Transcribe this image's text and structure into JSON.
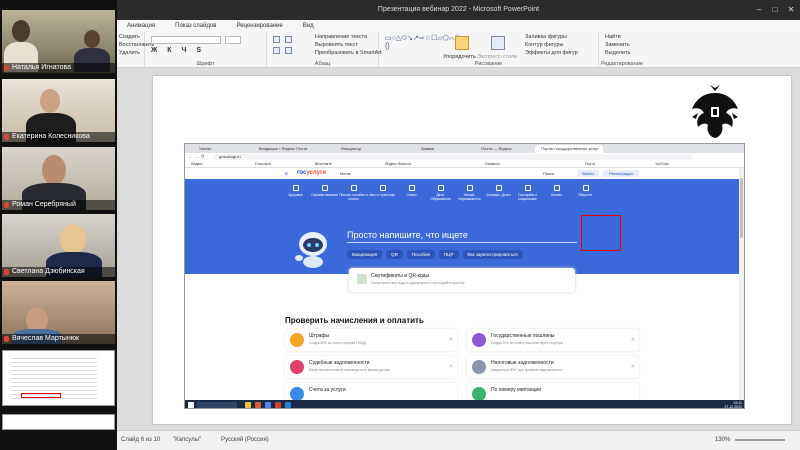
{
  "participants": [
    {
      "name": "Наталья Игнатова"
    },
    {
      "name": "Екатерина Колесникова"
    },
    {
      "name": "Роман Серебряный"
    },
    {
      "name": "Светлана Дзюбинская"
    },
    {
      "name": "Вячеслав Мартынюк"
    }
  ],
  "ppt": {
    "window_title": "Презентация вебинар 2022  -  Microsoft PowerPoint",
    "menu": [
      "Анимация",
      "Показ слайдов",
      "Рецензирование",
      "Вид"
    ],
    "ribbon": {
      "clipboard_items": [
        "Создать",
        "Восстановить",
        "Удалить"
      ],
      "font_label": "Шрифт",
      "paragraph_label": "Абзац",
      "paragraph_items": [
        "Направление текста",
        "Выровнять текст",
        "Преобразовать в SmartArt"
      ],
      "drawing_label": "Рисование",
      "arrange_label": "Упорядочить",
      "quick_styles_label": "Экспресс-стили",
      "shape_items": [
        "Заливка фигуры",
        "Контур фигуры",
        "Эффекты для фигур"
      ],
      "editing_label": "Редактирование",
      "editing_items": [
        "Найти",
        "Заменить",
        "Выделить"
      ]
    },
    "status": {
      "slide": "Слайд 6 из 10",
      "theme": "\"Капсулы\"",
      "language": "Русский (Россия)",
      "zoom": "130%"
    }
  },
  "browser": {
    "tabs": [
      "Узнать",
      "Входящие • Яндекс Почта",
      "Инициатор",
      "Заявки",
      "Почта — Яндекс",
      "Портал государственных услуг"
    ],
    "url": "gosuslugi.ru",
    "bookmarks": [
      "Яндекс",
      "Госуслуги",
      "ВКонтакте",
      "Яндекс Новости",
      "Сервисы",
      "Почта",
      "YouTube"
    ],
    "header": {
      "logo_a": "гос",
      "logo_b": "услуги",
      "menu": "Меню",
      "search": "Поиск",
      "login": "Войти",
      "register": "Регистрация"
    },
    "nav": [
      {
        "label": "Здоровье"
      },
      {
        "label": "Справки выписки"
      },
      {
        "label": "Пенсии, пособия и льготы"
      },
      {
        "label": "Авто и транспорт"
      },
      {
        "label": "Семья"
      },
      {
        "label": "Дети. Образование"
      },
      {
        "label": "Жильё. Недвижимость"
      },
      {
        "label": "Штрафы. Долги"
      },
      {
        "label": "Госслужба и социальные"
      },
      {
        "label": "Бизнес"
      },
      {
        "label": "Обществ."
      }
    ],
    "search_prompt": "Просто напишите, что ищете",
    "chips": [
      "Вакцинация",
      "QR",
      "Пособия",
      "ПЦР",
      "Как зарегистрироваться"
    ],
    "card": {
      "title": "Сертификаты и QR-коды",
      "subtitle": "Посмотрите все коды в одном месте или подайте жалобу"
    },
    "check_title": "Проверить начисления и оплатить",
    "services": [
      {
        "title": "Штрафы",
        "subtitle": "Скидка 50% на оплату штрафа ГИБДД"
      },
      {
        "title": "Государственные пошлины",
        "subtitle": "Скидка 30% на оплату пошлины через госуслуги"
      },
      {
        "title": "Судебные задолженности",
        "subtitle": "Поиск исполнительных производств по вашим данным"
      },
      {
        "title": "Налоговые задолженности",
        "subtitle": "Сведения из ФНС для проверки задолженности"
      },
      {
        "title": "Счета за услуги",
        "subtitle": ""
      },
      {
        "title": "По номеру квитанции",
        "subtitle": ""
      }
    ],
    "clock": {
      "time": "15:11",
      "date": "27.12.2021"
    }
  },
  "colors": {
    "gosuslugi_blue": "#3a6ad9",
    "logo_blue": "#0d4cd3",
    "logo_red": "#e8503a",
    "highlight": "#ee0000"
  }
}
